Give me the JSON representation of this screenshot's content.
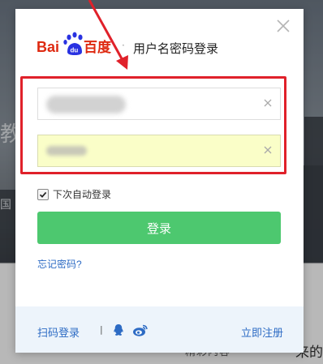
{
  "background": {
    "text_1": "教",
    "text_2": "国",
    "text_3": "来的",
    "text_4": "精彩内容"
  },
  "dialog": {
    "logo_text": "Bai du 百度",
    "logo_du": "du",
    "title": "用户名密码登录",
    "close_icon": "close-icon",
    "username": {
      "value": "",
      "placeholder": "",
      "blurred": true
    },
    "password": {
      "value": "",
      "placeholder": "",
      "blurred": true
    },
    "remember_label": "下次自动登录",
    "remember_checked": true,
    "login_button": "登录",
    "forgot_link": "忘记密码?",
    "footer": {
      "scan_login": "扫码登录",
      "separator": "|",
      "qq_icon": "qq-icon",
      "weibo_icon": "weibo-icon",
      "register": "立即注册"
    }
  },
  "colors": {
    "accent_green": "#4dc86f",
    "link_blue": "#2d6bc4",
    "highlight_red": "#e0212a",
    "autofill_yellow": "#fafec8",
    "baidu_red": "#de2910",
    "baidu_blue": "#2932e1"
  }
}
